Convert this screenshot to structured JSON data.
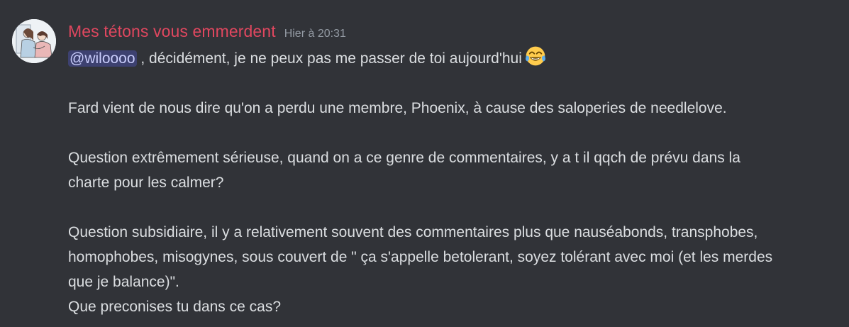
{
  "message": {
    "author": "Mes tétons vous emmerdent",
    "timestamp": "Hier à 20:31",
    "author_color": "#e0475f",
    "avatar_icon": "avatar-illustration",
    "mention": "@wiloooo",
    "line1_after_mention": ", décidément, je ne peux pas me passer de toi aujourd'hui",
    "emoji": "joy-emoji",
    "para2": "Fard vient de nous dire qu'on a perdu une membre, Phoenix, à cause des saloperies de needlelove.",
    "para3_line1": "Question extrêmement sérieuse, quand on a ce genre de commentaires, y a t il qqch de prévu dans la",
    "para3_line2": "charte pour les calmer?",
    "para4_line1": "Question subsidiaire, il y a relativement souvent des commentaires plus que nauséabonds, transphobes,",
    "para4_line2": "homophobes, misogynes, sous couvert de \" ça s'appelle betolerant, soyez tolérant avec moi (et les merdes",
    "para4_line3": "que je balance)\".",
    "para5": "Que preconises tu dans ce cas?"
  }
}
